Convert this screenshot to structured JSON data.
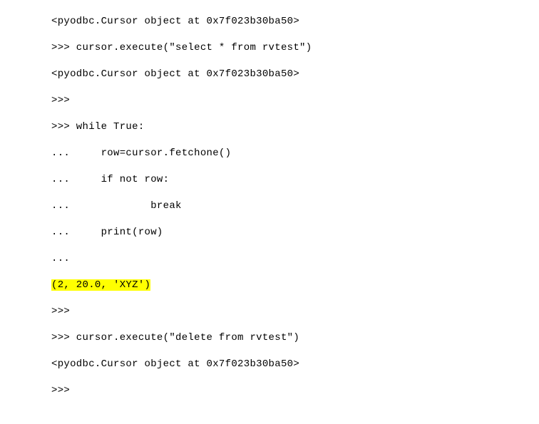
{
  "lines": [
    {
      "text": "<pyodbc.Cursor object at 0x7f023b30ba50>",
      "highlight": false
    },
    {
      "text": ">>> cursor.execute(\"select * from rvtest\")",
      "highlight": false
    },
    {
      "text": "<pyodbc.Cursor object at 0x7f023b30ba50>",
      "highlight": false
    },
    {
      "text": ">>>",
      "highlight": false
    },
    {
      "text": ">>> while True:",
      "highlight": false
    },
    {
      "text": "...     row=cursor.fetchone()",
      "highlight": false
    },
    {
      "text": "...     if not row:",
      "highlight": false
    },
    {
      "text": "...             break",
      "highlight": false
    },
    {
      "text": "...     print(row)",
      "highlight": false
    },
    {
      "text": "...",
      "highlight": false
    },
    {
      "text": "(2, 20.0, 'XYZ')",
      "highlight": true
    },
    {
      "text": ">>>",
      "highlight": false
    },
    {
      "text": ">>> cursor.execute(\"delete from rvtest\")",
      "highlight": false
    },
    {
      "text": "<pyodbc.Cursor object at 0x7f023b30ba50>",
      "highlight": false
    },
    {
      "text": ">>>",
      "highlight": false
    }
  ]
}
